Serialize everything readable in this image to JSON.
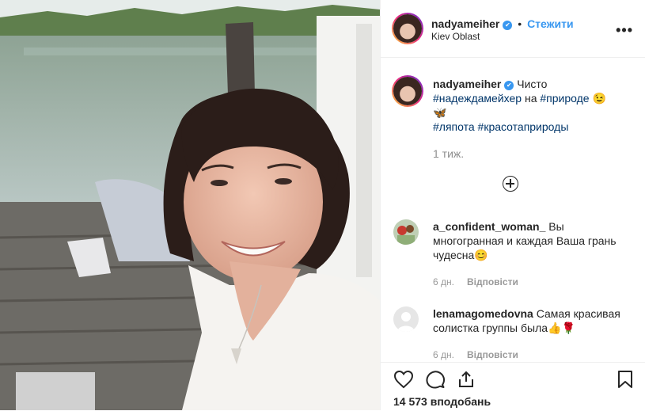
{
  "post": {
    "username": "nadyameiher",
    "follow_label": "Стежити",
    "location": "Kiev Oblast",
    "more_glyph": "•••"
  },
  "caption": {
    "username": "nadyameiher",
    "text_start": "Чисто",
    "tag1": "#надеждамейхер",
    "word_na": "на",
    "tag2": "#природе",
    "emoji_smile": "😉",
    "emoji_butterfly": "🦋",
    "tag3": "#ляпота",
    "tag4": "#красотаприроды",
    "time_ago": "1 тиж."
  },
  "comments": [
    {
      "username": "a_confident_woman_",
      "text": "Вы многогранная и каждая Ваша грань чудесна😊",
      "time": "6 дн.",
      "reply_label": "Відповісти"
    },
    {
      "username": "lenamagomedovna",
      "text": "Самая красивая солистка группы была👍🌹",
      "time": "6 дн.",
      "reply_label": "Відповісти"
    }
  ],
  "footer": {
    "likes_text": "14 573 вподобань",
    "icons": [
      "heart-icon",
      "comment-icon",
      "share-icon",
      "bookmark-icon"
    ]
  },
  "colors": {
    "link": "#3897f0",
    "hashtag": "#003569",
    "muted": "#8e8e8e",
    "border": "#efefef"
  }
}
